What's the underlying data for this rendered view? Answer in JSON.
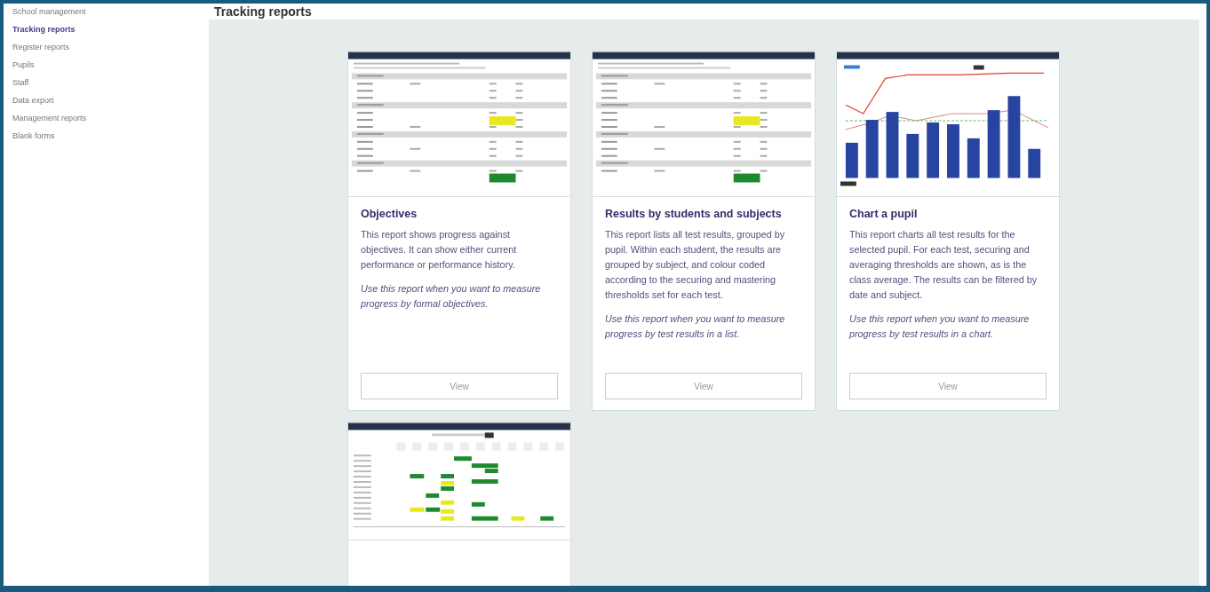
{
  "sidebar": {
    "items": [
      {
        "label": "School management",
        "selected": false
      },
      {
        "label": "Tracking reports",
        "selected": true
      },
      {
        "label": "Register reports",
        "selected": false
      },
      {
        "label": "Pupils",
        "selected": false
      },
      {
        "label": "Staff",
        "selected": false
      },
      {
        "label": "Data export",
        "selected": false
      },
      {
        "label": "Management reports",
        "selected": false
      },
      {
        "label": "Blank forms",
        "selected": false
      }
    ]
  },
  "page": {
    "title": "Tracking reports"
  },
  "cards": [
    {
      "kind": "table",
      "title": "Objectives",
      "description": "This report shows progress against objectives. It can show either current performance or performance history.",
      "usage": "Use this report when you want to measure progress by *formal objectives*.",
      "button": "View"
    },
    {
      "kind": "table",
      "title": "Results by students and subjects",
      "description": "This report lists all test results, grouped by pupil. Within each student, the results are grouped by subject, and colour coded according to the securing and mastering thresholds set for each test.",
      "usage": "Use this report when you want to measure progress by test results in a list.",
      "button": "View"
    },
    {
      "kind": "chart",
      "title": "Chart a pupil",
      "description": "This report charts all test results for the selected pupil. For each test, securing and averaging thresholds are shown, as is the class average. The results can be filtered by date and subject.",
      "usage": "Use this report when you want to measure progress by test results in a chart.",
      "button": "View"
    },
    {
      "kind": "grid"
    }
  ]
}
